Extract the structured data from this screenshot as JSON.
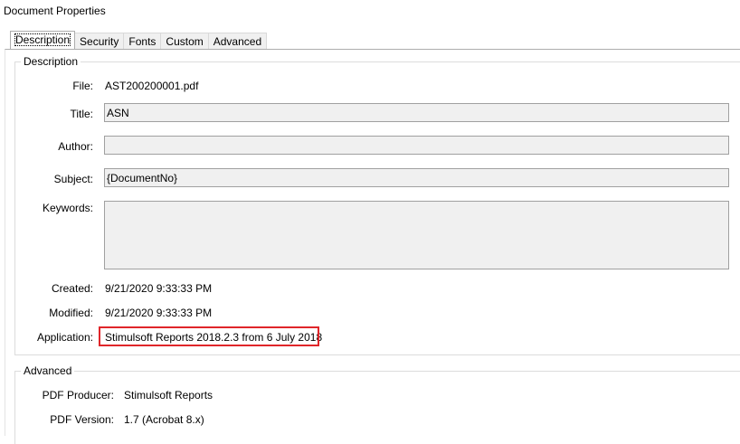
{
  "window": {
    "title": "Document Properties"
  },
  "tabs": [
    {
      "label": "Description",
      "active": true
    },
    {
      "label": "Security",
      "active": false
    },
    {
      "label": "Fonts",
      "active": false
    },
    {
      "label": "Custom",
      "active": false
    },
    {
      "label": "Advanced",
      "active": false
    }
  ],
  "description": {
    "legend": "Description",
    "file_label": "File:",
    "file_value": "AST200200001.pdf",
    "title_label": "Title:",
    "title_value": "ASN",
    "author_label": "Author:",
    "author_value": "",
    "subject_label": "Subject:",
    "subject_value": "{DocumentNo}",
    "keywords_label": "Keywords:",
    "keywords_value": "",
    "created_label": "Created:",
    "created_value": "9/21/2020 9:33:33 PM",
    "modified_label": "Modified:",
    "modified_value": "9/21/2020 9:33:33 PM",
    "application_label": "Application:",
    "application_value": "Stimulsoft Reports 2018.2.3 from 6 July 2018"
  },
  "advanced": {
    "legend": "Advanced",
    "producer_label": "PDF Producer:",
    "producer_value": "Stimulsoft Reports",
    "version_label": "PDF Version:",
    "version_value": "1.7 (Acrobat 8.x)"
  },
  "colors": {
    "highlight": "#e0262a",
    "field_bg": "#f0f0f0"
  }
}
